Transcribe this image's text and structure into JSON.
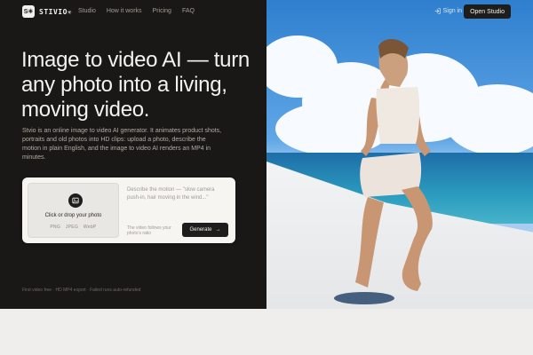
{
  "brand": {
    "mark": "S✳",
    "name": "STIVIO✳"
  },
  "nav": {
    "items": [
      "Studio",
      "How it works",
      "Pricing",
      "FAQ"
    ]
  },
  "header": {
    "signin_label": "Sign in",
    "open_studio_label": "Open Studio"
  },
  "hero": {
    "headline": "Image to video AI — turn any photo into a living, moving video.",
    "description": "Stvio is an online image to video AI generator. It animates product shots, portraits and old photos into HD clips: upload a photo, describe the motion in plain English, and the image to video AI renders an MP4 in minutes."
  },
  "upload": {
    "drop_label": "Click or drop your photo",
    "formats": [
      "PNG",
      "JPEG",
      "WebP"
    ],
    "prompt_placeholder": "Describe the motion — \"slow camera push-in, hair moving in the wind...\"",
    "aspect_note": "The video follows your photo's ratio",
    "generate_label": "Generate",
    "generate_arrow": "→"
  },
  "footnote": "First video free · HD MP4 export · Failed runs auto-refunded",
  "colors": {
    "dark_panel": "#1a1816",
    "accent_light": "#f6f5f2",
    "page_bg": "#efeeec"
  }
}
